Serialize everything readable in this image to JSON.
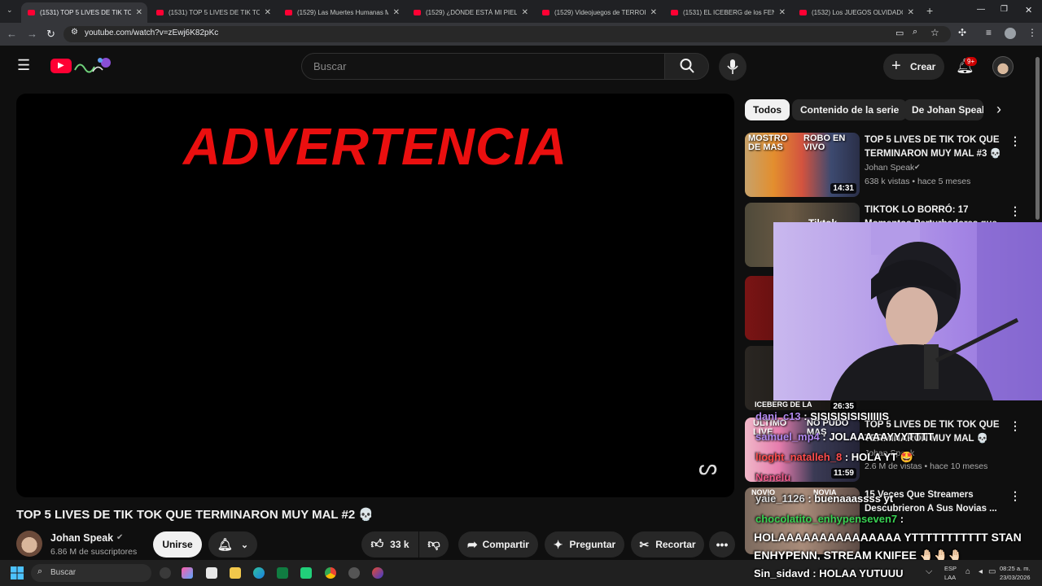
{
  "browser": {
    "tabs": [
      {
        "label": "(1531) TOP 5 LIVES DE TIK TOK",
        "active": true
      },
      {
        "label": "(1531) TOP 5 LIVES DE TIK TOK",
        "active": false
      },
      {
        "label": "(1529) Las Muertes Humanas M",
        "active": false
      },
      {
        "label": "(1529) ¿DÓNDE ESTÁ MI PIEL? ",
        "active": false
      },
      {
        "label": "(1529) Videojuegos de TERROR",
        "active": false
      },
      {
        "label": "(1531) EL ICEBERG de los FENÓ",
        "active": false
      },
      {
        "label": "(1532) Los JUEGOS OLVIDADOS",
        "active": false
      }
    ],
    "new_tab": "+",
    "url": "youtube.com/watch?v=zEwj6K82pKc"
  },
  "header": {
    "search_placeholder": "Buscar",
    "create_label": "Crear",
    "notif_badge": "9+"
  },
  "video": {
    "warning_text": "ADVERTENCIA",
    "title": "TOP 5 LIVES DE TIK TOK QUE TERMINARON MUY MAL #2 💀"
  },
  "channel": {
    "name": "Johan Speak",
    "subscribers": "6.86 M de suscriptores",
    "join_label": "Unirse",
    "likes": "33 k",
    "share_label": "Compartir",
    "ask_label": "Preguntar",
    "clip_label": "Recortar"
  },
  "chips": [
    "Todos",
    "Contenido de la serie",
    "De Johan Speak"
  ],
  "recommended": [
    {
      "title": "TOP 5 LIVES DE TIK TOK QUE TERMINARON MUY MAL #3 💀",
      "channel": "Johan Speak",
      "meta": "638 k vistas • hace 5 meses",
      "duration": "14:31",
      "thumb_text_a": "MOSTRO DE MAS",
      "thumb_text_b": "ROBO EN VIVO"
    },
    {
      "title": "TIKTOK LO BORRÓ: 17 Momentos Perturbadores que",
      "channel": "",
      "meta": "",
      "duration": "",
      "thumb_text_a": "Tiktok",
      "thumb_text_b": ""
    },
    {
      "title": "TOP 5 LIVES DE TIK TOK QUE TERMINARON MUY MAL 💀",
      "channel": "Johan Speak",
      "meta": "2.6 M de vistas • hace 10 meses",
      "duration": "11:59",
      "thumb_text_a": "ULTIMO LIVE",
      "thumb_text_b": "NO PUDO MAS"
    },
    {
      "title": "15 Veces Que Streamers Descubrieron A Sus Novias ...",
      "channel": "",
      "meta": "",
      "duration": "",
      "thumb_text_a": "NOVIO",
      "thumb_text_b": "NOVIA"
    }
  ],
  "overlay_duration": "26:35",
  "overlay_thumb_text": "ICEBERG DE LA",
  "chat": [
    {
      "name": "dani_c13",
      "msg": " : SISISISISISIIIIIS"
    },
    {
      "name": "samuel_mp4",
      "msg": " : JOLAAAAAYYYTTTT"
    },
    {
      "name": "lioght_natalleh_8",
      "msg": " : HOLA YT 🤩"
    },
    {
      "name": "Nenelu",
      "msg": ""
    },
    {
      "name": "yaie_1126",
      "msg": " : buenaaassss yt"
    },
    {
      "name": "chocolatito_enhypenseven7",
      "msg": " :"
    },
    {
      "name": "",
      "msg": "HOLAAAAAAAAAAAAAAA YTTTTTTTTTTT STAN"
    },
    {
      "name": "",
      "msg": "ENHYPENN, STREAM KNIFEE 🤚🏻🤚🏻🤚🏻"
    },
    {
      "name": "Sin_sidavd",
      "msg": " : HOLAA YUTUUU"
    }
  ],
  "taskbar": {
    "search_label": "Buscar",
    "lang_top": "ESP",
    "lang_bottom": "LAA",
    "time": "08:25 a. m.",
    "date": "23/03/2026"
  }
}
